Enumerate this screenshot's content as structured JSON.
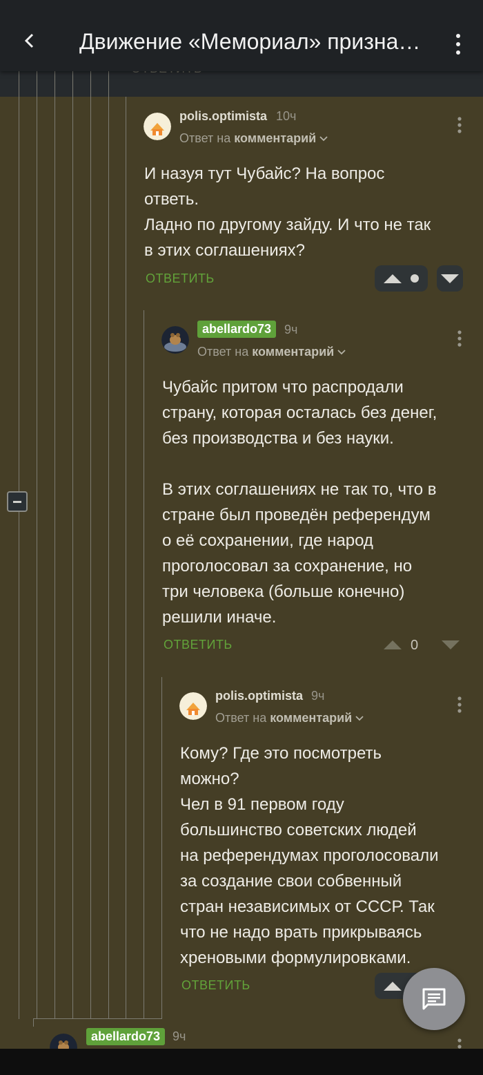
{
  "topbar": {
    "title": "Движение «Мемориал» призна…"
  },
  "peek_text": "ОТВЕТИТЬ",
  "comments": [
    {
      "user": "polis.optimista",
      "time": "10ч",
      "reply_prefix": "Ответ на",
      "reply_target": "комментарий",
      "text": "И назуя тут Чубайс? На вопрос\nответь.\nЛадно по другому зайду. И что не так\nв этих соглашениях?",
      "answer": "ОТВЕТИТЬ",
      "score": ""
    },
    {
      "user": "abellardo73",
      "time": "9ч",
      "reply_prefix": "Ответ на",
      "reply_target": "комментарий",
      "text": "Чубайс притом что распродали\nстрану, которая осталась без денег,\nбез производства и без науки.\n\nВ этих соглашениях не так то, что в\nстране был проведён референдум\nо её сохранении, где народ\nпроголосовал за сохранение, но\nтри человека (больше конечно)\nрешили иначе.",
      "answer": "ОТВЕТИТЬ",
      "score": "0"
    },
    {
      "user": "polis.optimista",
      "time": "9ч",
      "reply_prefix": "Ответ на",
      "reply_target": "комментарий",
      "text": "Кому? Где это посмотреть\nможно?\nЧел в 91 первом году\nбольшинство советских людей\nна референдумах проголосовали\nза создание свои собвенный\nстран независимых от СССР. Так\nчто не надо врать прикрываясь\nхреновыми формулировками.",
      "answer": "ОТВЕТИТЬ"
    },
    {
      "user": "abellardo73",
      "time": "9ч"
    }
  ],
  "colors": {
    "background": "#453e26",
    "answer_green": "#62a33a",
    "badge_green": "#5fa13a",
    "topbar": "#1f2225"
  },
  "icons": [
    "back-arrow-icon",
    "more-vert-icon",
    "chevron-down-icon",
    "arrow-up-icon",
    "arrow-down-icon",
    "collapse-icon",
    "comment-icon"
  ]
}
